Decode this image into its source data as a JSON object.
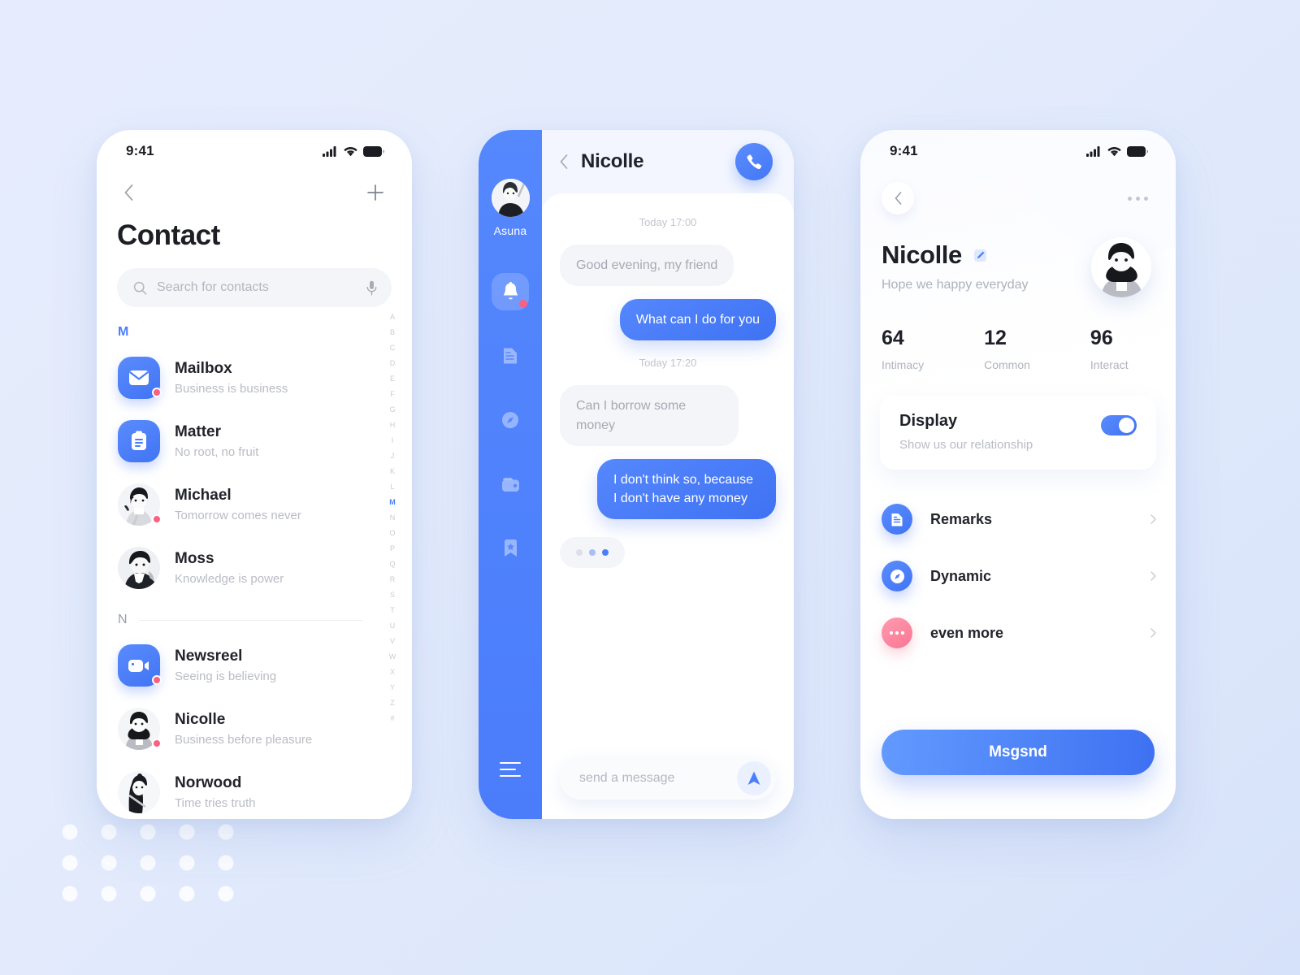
{
  "theme": {
    "primary": "#4a7efd",
    "primary_dark": "#3f72f3",
    "accent_pink": "#fb5f81",
    "page_bg": "#e4ebfc",
    "text_dark": "#1d1f25",
    "text_muted": "#b5b8c2"
  },
  "contacts_screen": {
    "status_bar": {
      "time": "9:41"
    },
    "back_label": "back",
    "add_label": "add",
    "title": "Contact",
    "search": {
      "placeholder": "Search for contacts",
      "icon": "search-icon",
      "mic_icon": "microphone-icon"
    },
    "sections": [
      {
        "letter": "M",
        "items": [
          {
            "name": "Mailbox",
            "subtitle": "Business is business",
            "icon": "mail-icon",
            "kind": "app",
            "badge": true
          },
          {
            "name": "Matter",
            "subtitle": "No root, no fruit",
            "icon": "clipboard-icon",
            "kind": "app",
            "badge": false
          },
          {
            "name": "Michael",
            "subtitle": "Tomorrow comes never",
            "icon": "avatar-photo",
            "kind": "person",
            "badge": true
          },
          {
            "name": "Moss",
            "subtitle": "Knowledge is power",
            "icon": "avatar-photo",
            "kind": "person",
            "badge": false
          }
        ]
      },
      {
        "letter": "N",
        "items": [
          {
            "name": "Newsreel",
            "subtitle": "Seeing is believing",
            "icon": "video-icon",
            "kind": "app",
            "badge": true
          },
          {
            "name": "Nicolle",
            "subtitle": "Business before pleasure",
            "icon": "avatar-photo",
            "kind": "person",
            "badge": true
          },
          {
            "name": "Norwood",
            "subtitle": "Time tries truth",
            "icon": "avatar-photo",
            "kind": "person",
            "badge": false
          }
        ]
      }
    ],
    "alpha_index": [
      "A",
      "B",
      "C",
      "D",
      "E",
      "F",
      "G",
      "H",
      "I",
      "J",
      "K",
      "L",
      "M",
      "N",
      "O",
      "P",
      "Q",
      "R",
      "S",
      "T",
      "U",
      "V",
      "W",
      "X",
      "Y",
      "Z",
      "#"
    ],
    "alpha_active": "M"
  },
  "chat_screen": {
    "rail": {
      "user_name": "Asuna",
      "items": [
        {
          "icon": "bell-icon",
          "active": true,
          "badge": true
        },
        {
          "icon": "document-icon",
          "active": false,
          "badge": false
        },
        {
          "icon": "compass-icon",
          "active": false,
          "badge": false
        },
        {
          "icon": "wallet-icon",
          "active": false,
          "badge": false
        },
        {
          "icon": "bookmark-star-icon",
          "active": false,
          "badge": false
        }
      ],
      "menu_icon": "hamburger-icon"
    },
    "header": {
      "back_icon": "chevron-left-icon",
      "title": "Nicolle",
      "call_icon": "phone-icon"
    },
    "messages": [
      {
        "type": "time",
        "text": "Today 17:00"
      },
      {
        "type": "incoming",
        "text": "Good evening, my friend"
      },
      {
        "type": "outgoing",
        "text": "What can I do for you"
      },
      {
        "type": "time",
        "text": "Today 17:20"
      },
      {
        "type": "incoming",
        "text": "Can I borrow some money"
      },
      {
        "type": "outgoing",
        "text": "I don't think so, because I don't have any money"
      },
      {
        "type": "typing",
        "text": ""
      }
    ],
    "composer": {
      "placeholder": "send a message",
      "send_icon": "send-navigation-icon"
    }
  },
  "profile_screen": {
    "status_bar": {
      "time": "9:41"
    },
    "back_icon": "chevron-left-icon",
    "more_icon": "more-horizontal-icon",
    "name": "Nicolle",
    "edit_icon": "edit-pencil-icon",
    "tagline": "Hope we happy everyday",
    "avatar_icon": "avatar-photo",
    "stats": [
      {
        "value": "64",
        "label": "Intimacy"
      },
      {
        "value": "12",
        "label": "Common"
      },
      {
        "value": "96",
        "label": "Interact"
      }
    ],
    "display_card": {
      "title": "Display",
      "subtitle": "Show us our relationship",
      "toggle_on": true
    },
    "menu": [
      {
        "label": "Remarks",
        "icon": "document-icon",
        "color": "blue"
      },
      {
        "label": "Dynamic",
        "icon": "compass-icon",
        "color": "blue"
      },
      {
        "label": "even more",
        "icon": "ellipsis-icon",
        "color": "pink"
      }
    ],
    "primary_button": "Msgsnd"
  }
}
